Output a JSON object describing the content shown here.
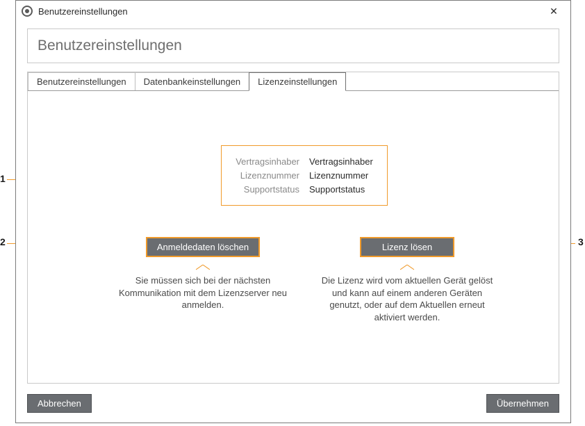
{
  "window": {
    "title": "Benutzereinstellungen"
  },
  "heading": "Benutzereinstellungen",
  "tabs": [
    {
      "label": "Benutzereinstellungen",
      "active": false
    },
    {
      "label": "Datenbankeinstellungen",
      "active": false
    },
    {
      "label": "Lizenzeinstellungen",
      "active": true
    }
  ],
  "license_info": {
    "rows": [
      {
        "label": "Vertragsinhaber",
        "value": "Vertragsinhaber"
      },
      {
        "label": "Lizenznummer",
        "value": "Lizenznummer"
      },
      {
        "label": "Supportstatus",
        "value": "Supportstatus"
      }
    ]
  },
  "actions": {
    "delete_credentials": {
      "label": "Anmeldedaten löschen",
      "description": "Sie müssen sich bei der nächsten Kommunikation mit dem Lizenzserver neu anmelden."
    },
    "release_license": {
      "label": "Lizenz lösen",
      "description": "Die Lizenz wird vom aktuellen Gerät gelöst und kann auf einem anderen Geräten genutzt, oder auf dem Aktuellen erneut aktiviert werden."
    }
  },
  "footer": {
    "cancel": "Abbrechen",
    "apply": "Übernehmen"
  },
  "callouts": {
    "c1": "1",
    "c2": "2",
    "c3": "3"
  },
  "colors": {
    "accent": "#f09a2a",
    "button_bg": "#6a6d71"
  }
}
